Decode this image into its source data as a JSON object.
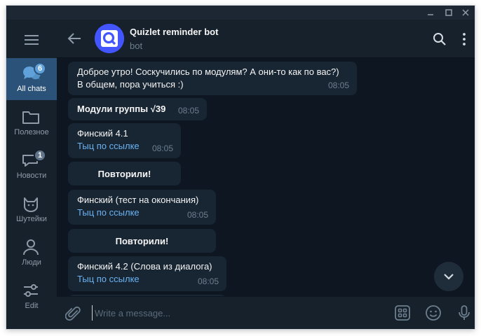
{
  "window": {
    "controls": [
      "minimize-icon",
      "maximize-icon",
      "close-icon"
    ]
  },
  "sidebar": {
    "menu_icon": "hamburger-menu-icon",
    "folders": [
      {
        "label": "All chats",
        "icon": "chats-icon",
        "badge": "6",
        "active": true
      },
      {
        "label": "Полезное",
        "icon": "folder-icon",
        "badge": "",
        "active": false
      },
      {
        "label": "Новости",
        "icon": "chat-bubble-icon",
        "badge": "1",
        "active": false
      },
      {
        "label": "Шутейки",
        "icon": "cat-icon",
        "badge": "",
        "active": false
      },
      {
        "label": "Люди",
        "icon": "person-icon",
        "badge": "",
        "active": false
      },
      {
        "label": "Edit",
        "icon": "sliders-icon",
        "badge": "",
        "active": false
      }
    ]
  },
  "header": {
    "title": "Quizlet reminder bot",
    "status": "bot",
    "avatar_letter": "Q",
    "avatar_color": "#4255ff"
  },
  "messages": [
    {
      "type": "text",
      "lines": [
        "Доброе утро! Соскучились по модулям? А они-то как по вас?)",
        "В общем, пора учиться :)"
      ],
      "time": "08:05"
    },
    {
      "type": "text_bold",
      "text": "Модули группы √39",
      "time": "08:05"
    },
    {
      "type": "link",
      "text": "Финский 4.1",
      "link": "Тыц по ссылке",
      "time": "08:05"
    },
    {
      "type": "button",
      "label": "Повторили!"
    },
    {
      "type": "link",
      "text": "Финский (тест на окончания)",
      "link": "Тыц по ссылке",
      "time": "08:05"
    },
    {
      "type": "button",
      "label": "Повторили!"
    },
    {
      "type": "link",
      "text": "Финский 4.2 (Слова из диалога)",
      "link": "Тыц по ссылке",
      "time": "08:05"
    }
  ],
  "composer": {
    "placeholder": "Write a message..."
  },
  "colors": {
    "background": "#0e1621",
    "panel": "#17212b",
    "bubble": "#182533",
    "active_folder": "#2b5278",
    "link": "#6ab3f3",
    "muted": "#6d7f8f"
  }
}
